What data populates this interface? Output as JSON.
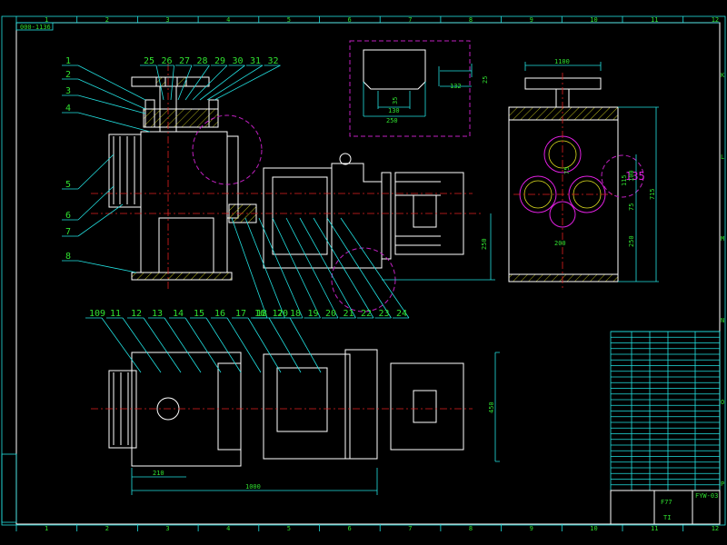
{
  "drawing": {
    "drawing_number": "000-1136",
    "title_block_name": "F77",
    "title_block_code": "FYW-03",
    "title_block_mark": "TI"
  },
  "grid": {
    "columns": [
      "1",
      "2",
      "3",
      "4",
      "5",
      "6",
      "7",
      "8",
      "9",
      "10",
      "11",
      "12",
      "13"
    ],
    "rows": [
      "K",
      "L",
      "M",
      "N",
      "O",
      "P"
    ]
  },
  "part_labels": {
    "left": [
      "1",
      "2",
      "3",
      "4",
      "5",
      "6",
      "7",
      "8"
    ],
    "top": [
      "25",
      "26",
      "27",
      "28",
      "29",
      "30",
      "31",
      "32"
    ],
    "middle": [
      "16",
      "17",
      "18",
      "19",
      "20",
      "21",
      "22",
      "23",
      "24"
    ],
    "plan": [
      "109",
      "11",
      "12",
      "13",
      "14",
      "15",
      "16",
      "17",
      "18",
      "20"
    ]
  },
  "dimensions": {
    "side_width": "1100",
    "side_height": "715",
    "side_base": "250",
    "side_spacing": "200",
    "side_v1": "75",
    "side_v2": "75",
    "side_v3": "115",
    "side_v4": "100",
    "side_dia_label": "135",
    "front_height": "250",
    "detail_width": "250",
    "detail_inner": "130",
    "detail_depth": "35",
    "detail_len": "132",
    "detail_h": "25",
    "plan_height": "450",
    "plan_offset": "210",
    "plan_length": "1000"
  },
  "colors": {
    "outline": "#ffffff",
    "dimension": "#22e0e0",
    "centerline": "#e02020",
    "circle": "#e020e0",
    "text": "#30e030",
    "hatch": "#e0e020"
  }
}
